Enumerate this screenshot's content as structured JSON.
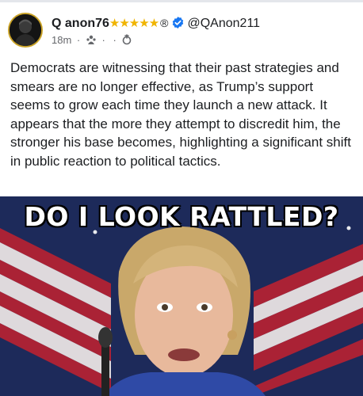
{
  "post": {
    "author_name": "Q anon76",
    "stars": "★★★★★",
    "registered_mark": "®",
    "handle": "@QAnon211",
    "time": "18m",
    "dot": "·",
    "text": "Democrats are witnessing that their past strategies and smears are no longer effective, as Trump’s support seems to grow each time they launch a new attack. It appears that the more they attempt to discredit him, the stronger his base becomes, highlighting a significant shift in public reaction to political tactics."
  },
  "image": {
    "caption": "DO I LOOK RATTLED?"
  },
  "icons": {
    "avatar": "avatar-portrait",
    "verified": "verified-badge-icon",
    "audience": "audience-icon",
    "pin": "pin-icon"
  },
  "colors": {
    "verified_blue": "#1877f2",
    "star_gold": "#f0b400",
    "meta_gray": "#65676b",
    "flag_blue": "#1d2a5a",
    "flag_red": "#b22234"
  }
}
